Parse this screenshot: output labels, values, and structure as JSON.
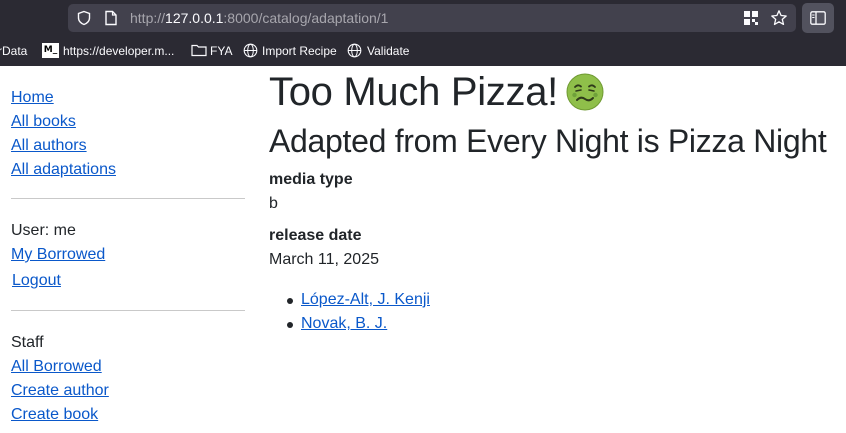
{
  "browser": {
    "url_prefix": "http://",
    "url_host": "127.0.0.1",
    "url_rest": ":8000/catalog/adaptation/1",
    "bookmarks": [
      {
        "label": "rData",
        "icon": "partial-bookmark"
      },
      {
        "label": "https://developer.m...",
        "icon": "mdn-logo-icon"
      },
      {
        "label": "FYA",
        "icon": "folder-icon"
      },
      {
        "label": "Import Recipe",
        "icon": "globe-icon"
      },
      {
        "label": "Validate",
        "icon": "globe-icon"
      }
    ],
    "mdn_logo_text": "M_"
  },
  "sidebar": {
    "nav": [
      "Home",
      "All books",
      "All authors",
      "All adaptations"
    ],
    "user_label": "User: me",
    "user_links": [
      "My Borrowed",
      "Logout"
    ],
    "staff_label": "Staff",
    "staff_links": [
      "All Borrowed",
      "Create author",
      "Create book"
    ]
  },
  "main": {
    "title": "Too Much Pizza!",
    "title_emoji": "nauseated-face-emoji",
    "subtitle": "Adapted from Every Night is Pizza Night",
    "fields": [
      {
        "label": "media type",
        "value": "b"
      },
      {
        "label": "release date",
        "value": "March 11, 2025"
      }
    ],
    "authors": [
      "López-Alt, J. Kenji",
      "Novak, B. J."
    ]
  }
}
